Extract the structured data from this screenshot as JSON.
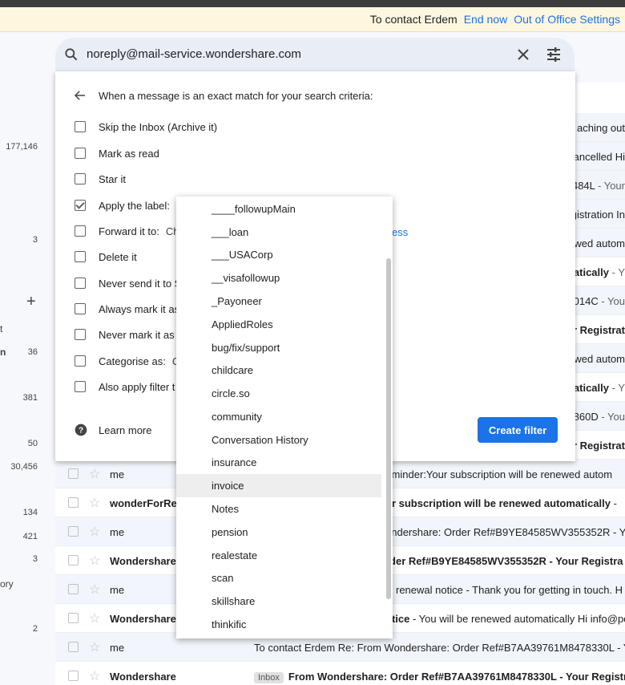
{
  "ooo_bar": {
    "text": "To contact Erdem",
    "end_now": "End now",
    "settings": "Out of Office Settings"
  },
  "search": {
    "value": "noreply@mail-service.wondershare.com"
  },
  "left_counts": [
    "177,146",
    "3",
    "36",
    "381",
    "50",
    "30,456",
    "134",
    "421",
    "3",
    "2"
  ],
  "left_fragments": [
    "t",
    "n",
    "ory"
  ],
  "filter": {
    "header": "When a message is an exact match for your search criteria:",
    "options": [
      {
        "label": "Skip the Inbox (Archive it)",
        "checked": false,
        "extra": ""
      },
      {
        "label": "Mark as read",
        "checked": false,
        "extra": ""
      },
      {
        "label": "Star it",
        "checked": false,
        "extra": ""
      },
      {
        "label": "Apply the label:",
        "checked": true,
        "extra": ""
      },
      {
        "label": "Forward it to:",
        "checked": false,
        "extra": "Ch"
      },
      {
        "label": "Delete it",
        "checked": false,
        "extra": ""
      },
      {
        "label": "Never send it to S",
        "checked": false,
        "extra": ""
      },
      {
        "label": "Always mark it as",
        "checked": false,
        "extra": ""
      },
      {
        "label": "Never mark it as i",
        "checked": false,
        "extra": ""
      },
      {
        "label": "Categorise as:",
        "checked": false,
        "extra": "C"
      },
      {
        "label": "Also apply filter t",
        "checked": false,
        "extra": ""
      }
    ],
    "forward_link_fragment": "ess",
    "learn_more": "Learn more",
    "create_button": "Create filter"
  },
  "label_dropdown": {
    "items": [
      "____followupMain",
      "___loan",
      "___USACorp",
      "__visafollowup",
      "_Payoneer",
      "AppliedRoles",
      "bug/fix/support",
      "childcare",
      "circle.so",
      "community",
      "Conversation History",
      "insurance",
      "invoice",
      "Notes",
      "pension",
      "realestate",
      "scan",
      "skillshare",
      "thinkific"
    ],
    "highlighted": "invoice"
  },
  "email_rows_right": [
    {
      "text": "aching out",
      "snippet": "",
      "unread": false
    },
    {
      "text": "ancelled Hi",
      "snippet": "",
      "unread": false
    },
    {
      "text": "484L",
      "snippet": " - Your",
      "unread": false
    },
    {
      "text": "gistration In",
      "snippet": "",
      "unread": false
    },
    {
      "text": "wed autom",
      "snippet": "",
      "unread": false
    },
    {
      "text": "atically",
      "snippet": " - Y",
      "unread": true
    },
    {
      "text": "4014C",
      "snippet": " - You",
      "unread": false
    },
    {
      "text": "ur Registrat",
      "snippet": "",
      "unread": true
    },
    {
      "text": "wed autom",
      "snippet": "",
      "unread": false
    },
    {
      "text": "atically",
      "snippet": " - Y",
      "unread": true
    },
    {
      "text": "860D",
      "snippet": " - You",
      "unread": false
    },
    {
      "text": "ur Registrat",
      "snippet": "",
      "unread": true
    }
  ],
  "email_rows_full": [
    {
      "sender": "me",
      "badge": "",
      "subject": "",
      "snippet": "reminder:Your subscription will be renewed autom",
      "unread": false
    },
    {
      "sender": "wonderForRe",
      "badge": "",
      "subject": "ur subscription will be renewed automatically",
      "snippet": " -",
      "unread": true
    },
    {
      "sender": "me",
      "badge": "",
      "subject": "",
      "snippet": "ondershare: Order Ref#B9YE84585WV355352R - You",
      "unread": false
    },
    {
      "sender": "Wondershare",
      "badge": "",
      "subject": "rder Ref#B9YE84585WV355352R - Your Registra",
      "snippet": "",
      "unread": true
    },
    {
      "sender": "me",
      "badge": "",
      "subject": "",
      "snippet": "ic renewal notice - Thank you for getting in touch. H",
      "unread": false
    },
    {
      "sender": "Wondershare",
      "badge": "",
      "subject": "otice",
      "snippet": " - You will be renewed automatically Hi info@pe",
      "unread": true
    },
    {
      "sender": "me",
      "badge": "",
      "subject": "",
      "snippet": "To contact Erdem Re: From Wondershare: Order Ref#B7AA39761M8478330L - You",
      "unread": false
    },
    {
      "sender": "Wondershare",
      "badge": "Inbox",
      "subject": "From Wondershare: Order Ref#B7AA39761M8478330L - Your Registrat",
      "snippet": "",
      "unread": true
    }
  ]
}
